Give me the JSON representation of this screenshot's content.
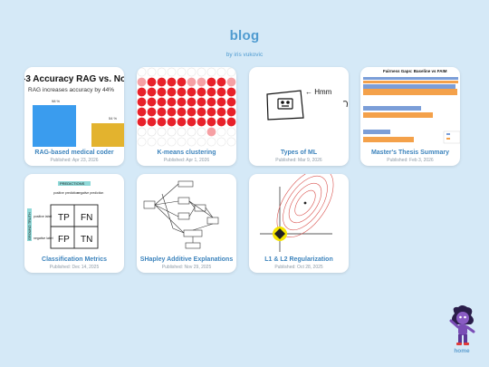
{
  "header": {
    "title": "blog",
    "byline": "by iris vukovic"
  },
  "cards": [
    {
      "title": "RAG-based medical coder",
      "date": "Published: Apr 23, 2026",
      "thumb": {
        "heading": "-3 Accuracy RAG vs. No R",
        "subheading": "RAG increases accuracy by 44%",
        "bar1_label": "98 %",
        "bar2_label": "54 %",
        "values": [
          98,
          54
        ]
      }
    },
    {
      "title": "K-means clustering",
      "date": "Published: Apr 1, 2026"
    },
    {
      "title": "Types of ML",
      "date": "Published: Mar 9, 2026",
      "thumb": {
        "note": "← Hmm"
      }
    },
    {
      "title": "Master's Thesis Summary",
      "date": "Published: Feb 3, 2026",
      "thumb": {
        "heading": "Fairness Gaps: Baseline vs FAIM"
      }
    },
    {
      "title": "Classification Metrics",
      "date": "Published: Dec 14, 2025",
      "thumb": {
        "top_label": "PREDICTIONS",
        "col1": "positive prediction",
        "col2": "negative prediction",
        "side_label": "GROUND TRUTH",
        "row1": "positive label",
        "row2": "negative label",
        "cells": [
          "TP",
          "FN",
          "FP",
          "TN"
        ]
      }
    },
    {
      "title": "SHapley Additive Explanations",
      "date": "Published: Nov 29, 2025"
    },
    {
      "title": "L1 & L2 Regularization",
      "date": "Published: Oct 28, 2025"
    }
  ],
  "nav": {
    "home_label": "home"
  },
  "colors": {
    "background": "#d5e9f7",
    "title": "#4f9bd0",
    "card_title": "#3d84bd",
    "cluster_red": "#e8212a",
    "bar_blue": "#3a9cee",
    "bar_gold": "#e3b32e"
  },
  "icons": {
    "home": "avatar-character-icon"
  }
}
